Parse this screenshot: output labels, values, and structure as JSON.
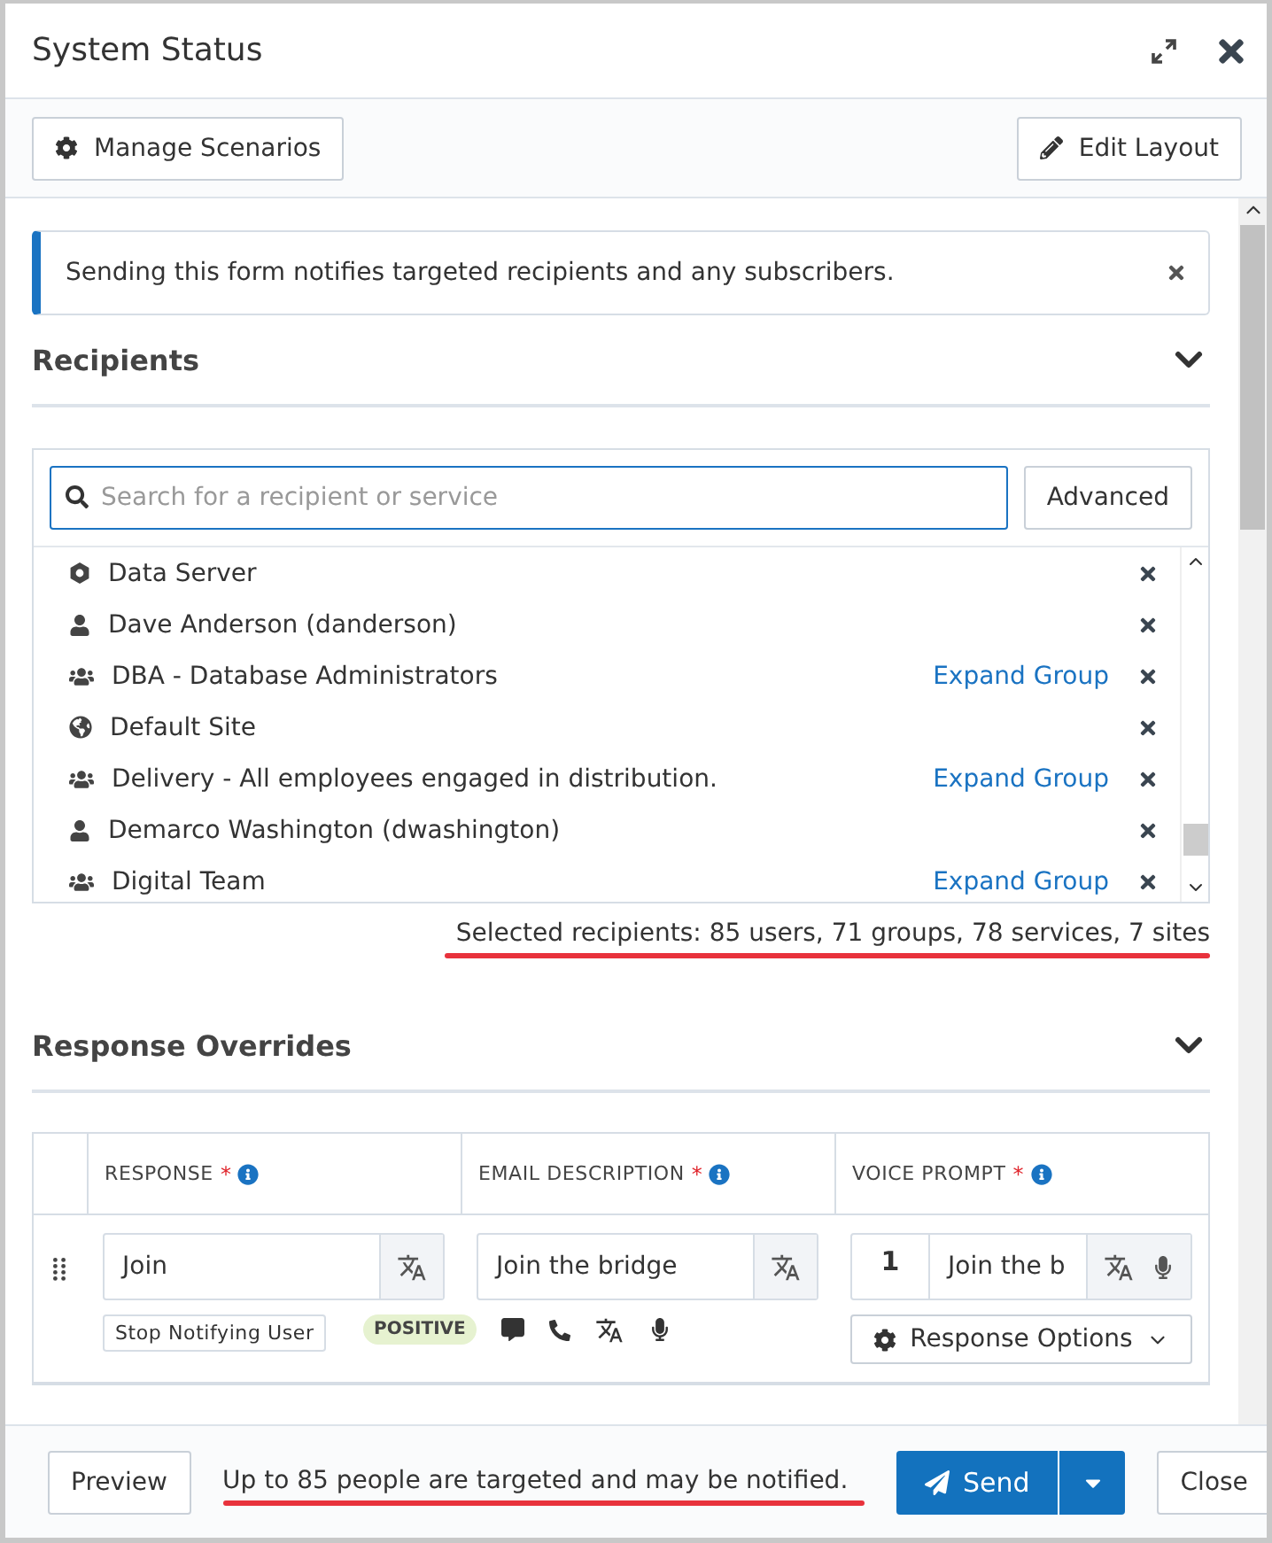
{
  "window": {
    "title": "System Status"
  },
  "toolbar": {
    "left_button": "Manage Scenarios",
    "right_button": "Edit Layout"
  },
  "notice": {
    "text": "Sending this form notifies targeted recipients and any subscribers."
  },
  "recipients": {
    "title": "Recipients",
    "expanded": true,
    "search": {
      "placeholder": "Search for a recipient or service"
    },
    "advanced_button": "Advanced",
    "items": [
      {
        "kind": "service",
        "name": "Data Server"
      },
      {
        "kind": "user",
        "name": "Dave Anderson (danderson)"
      },
      {
        "kind": "group",
        "name": "DBA - Database Administrators",
        "action": "Expand Group"
      },
      {
        "kind": "site",
        "name": "Default Site"
      },
      {
        "kind": "group",
        "name": "Delivery - All employees engaged in distribution.",
        "action": "Expand Group"
      },
      {
        "kind": "user",
        "name": "Demarco Washington (dwashington)"
      },
      {
        "kind": "group",
        "name": "Digital Team",
        "action": "Expand Group"
      }
    ],
    "summary": "Selected recipients: 85 users, 71 groups, 78 services, 7 sites"
  },
  "response_overrides": {
    "title": "Response Overrides",
    "expanded": true,
    "columns": [
      {
        "label": "RESPONSE",
        "required_mark": "*"
      },
      {
        "label": "EMAIL DESCRIPTION",
        "required_mark": "*"
      },
      {
        "label": "VOICE PROMPT",
        "required_mark": "*"
      }
    ],
    "rows": [
      {
        "response": "Join",
        "email_description": "Join the bridge",
        "voice_number": "1",
        "voice_prompt": "Join the b",
        "tag": "Stop Notifying User",
        "badge": "POSITIVE",
        "options_button": "Response Options"
      }
    ]
  },
  "footer": {
    "preview_button": "Preview",
    "message": "Up to 85 people are targeted and may be notified.",
    "send_button": "Send",
    "close_button": "Close"
  }
}
